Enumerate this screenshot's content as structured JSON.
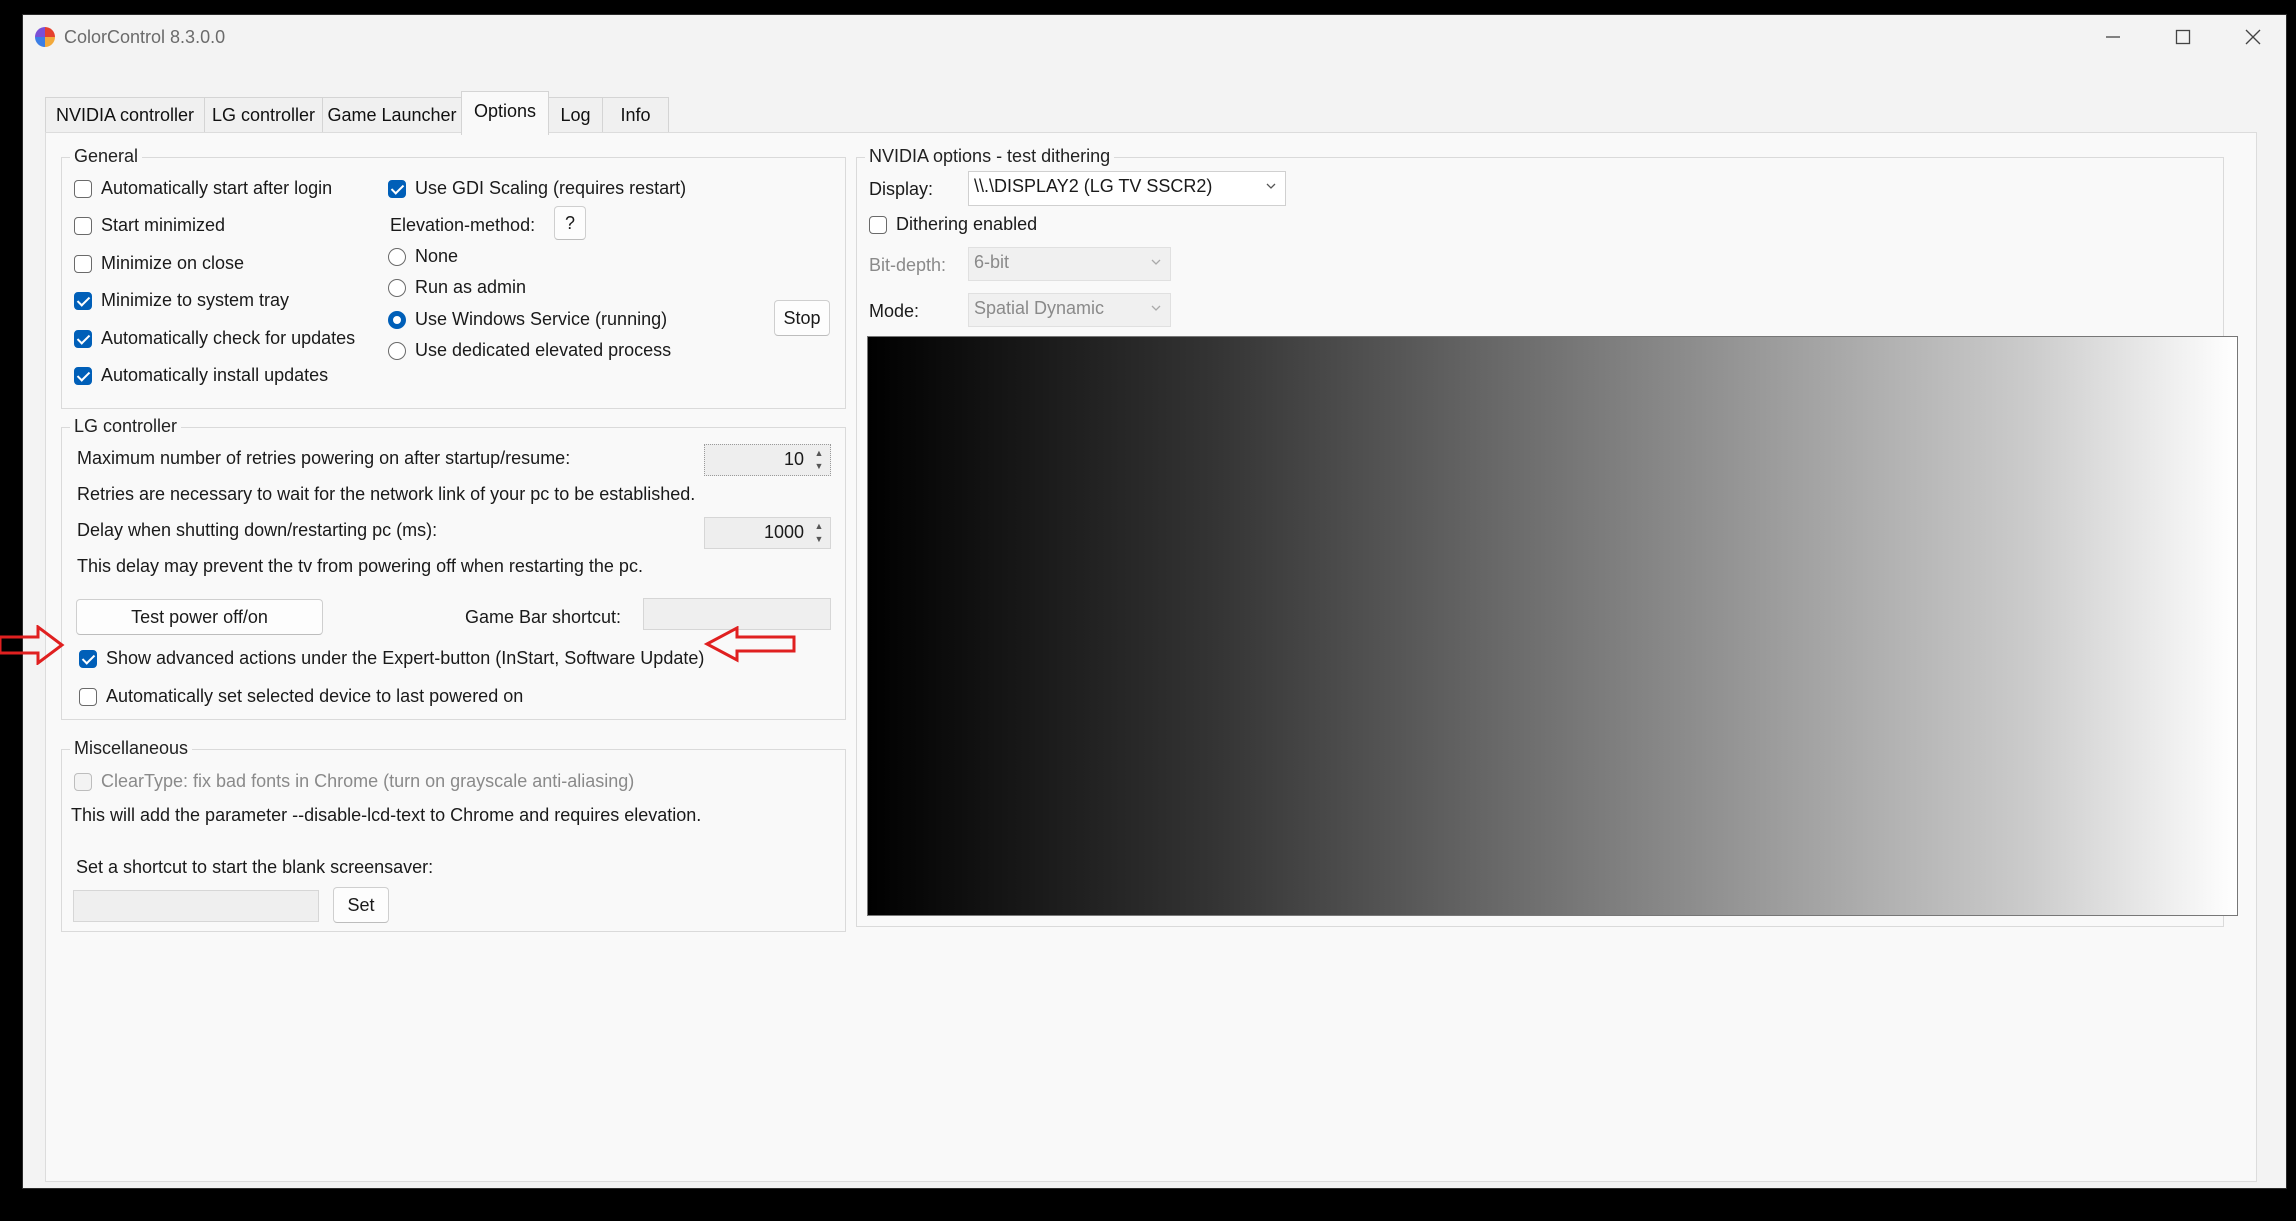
{
  "window": {
    "title": "ColorControl 8.3.0.0"
  },
  "tabs": [
    {
      "label": "NVIDIA controller",
      "active": false
    },
    {
      "label": "LG controller",
      "active": false
    },
    {
      "label": "Game Launcher",
      "active": false
    },
    {
      "label": "Options",
      "active": true
    },
    {
      "label": "Log",
      "active": false
    },
    {
      "label": "Info",
      "active": false
    }
  ],
  "general": {
    "title": "General",
    "auto_start": {
      "label": "Automatically start after login",
      "checked": false
    },
    "start_minimized": {
      "label": "Start minimized",
      "checked": false
    },
    "minimize_on_close": {
      "label": "Minimize on close",
      "checked": false
    },
    "minimize_to_tray": {
      "label": "Minimize to system tray",
      "checked": true
    },
    "auto_check_updates": {
      "label": "Automatically check for updates",
      "checked": true
    },
    "auto_install_updates": {
      "label": "Automatically install updates",
      "checked": true
    },
    "gdi_scaling": {
      "label": "Use GDI Scaling (requires restart)",
      "checked": true
    },
    "elevation_label": "Elevation-method:",
    "elevation_help": "?",
    "elevation_options": [
      {
        "label": "None",
        "selected": false
      },
      {
        "label": "Run as admin",
        "selected": false
      },
      {
        "label": "Use Windows Service (running)",
        "selected": true
      },
      {
        "label": "Use dedicated elevated process",
        "selected": false
      }
    ],
    "stop_button": "Stop"
  },
  "lg": {
    "title": "LG controller",
    "retries_label": "Maximum number of retries powering on after startup/resume:",
    "retries_value": "10",
    "retries_note": "Retries are necessary to wait for the network link of your pc to be established.",
    "delay_label": "Delay when shutting down/restarting pc (ms):",
    "delay_value": "1000",
    "delay_note": "This delay may prevent the tv from powering off when restarting the pc.",
    "test_button": "Test power off/on",
    "gamebar_label": "Game Bar shortcut:",
    "gamebar_value": "",
    "show_advanced": {
      "label": "Show advanced actions under the Expert-button (InStart, Software Update)",
      "checked": true
    },
    "auto_set_device": {
      "label": "Automatically set selected device to last powered on",
      "checked": false
    }
  },
  "misc": {
    "title": "Miscellaneous",
    "cleartype": {
      "label": "ClearType: fix bad fonts in Chrome (turn on grayscale anti-aliasing)",
      "checked": false,
      "disabled": true
    },
    "cleartype_note": "This will add the parameter --disable-lcd-text to Chrome and requires elevation.",
    "shortcut_label": "Set a shortcut to start the blank screensaver:",
    "shortcut_value": "",
    "set_button": "Set"
  },
  "nvidia": {
    "title": "NVIDIA options - test dithering",
    "display_label": "Display:",
    "display_value": "\\\\.\\DISPLAY2 (LG TV SSCR2)",
    "dithering": {
      "label": "Dithering enabled",
      "checked": false
    },
    "bitdepth_label": "Bit-depth:",
    "bitdepth_value": "6-bit",
    "mode_label": "Mode:",
    "mode_value": "Spatial Dynamic"
  },
  "annotations": {
    "arrow_color": "#e02020"
  },
  "colors": {
    "accent": "#005fb8"
  }
}
